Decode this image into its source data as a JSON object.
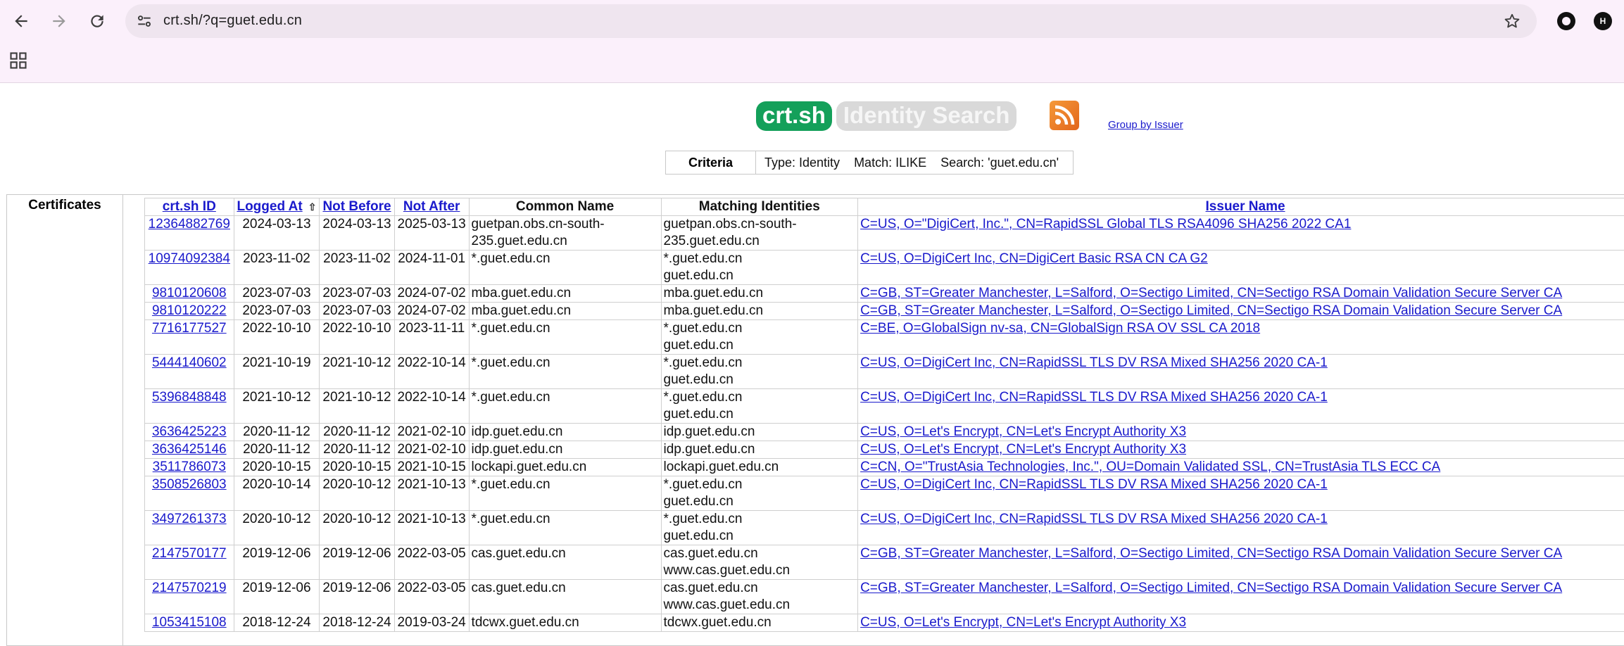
{
  "browser": {
    "url": "crt.sh/?q=guet.edu.cn",
    "profile_initial": "H"
  },
  "header": {
    "logo_main": "crt.sh",
    "logo_sub": "Identity Search",
    "group_link": "Group by Issuer"
  },
  "criteria": {
    "label": "Criteria",
    "text": "Type: Identity    Match: ILIKE    Search: 'guet.edu.cn'"
  },
  "table": {
    "section_label": "Certificates",
    "columns": {
      "id": "crt.sh ID",
      "logged_at": "Logged At",
      "sort_indicator": "⇧",
      "not_before": "Not Before",
      "not_after": "Not After",
      "common_name": "Common Name",
      "matching": "Matching Identities",
      "issuer": "Issuer Name"
    },
    "rows": [
      {
        "id": "12364882769",
        "logged": "2024-03-13",
        "nb": "2024-03-13",
        "na": "2025-03-13",
        "cn": "guetpan.obs.cn-south-235.guet.edu.cn",
        "match": "guetpan.obs.cn-south-235.guet.edu.cn",
        "issuer": "C=US, O=\"DigiCert, Inc.\", CN=RapidSSL Global TLS RSA4096 SHA256 2022 CA1"
      },
      {
        "id": "10974092384",
        "logged": "2023-11-02",
        "nb": "2023-11-02",
        "na": "2024-11-01",
        "cn": "*.guet.edu.cn",
        "match": "*.guet.edu.cn\nguet.edu.cn",
        "issuer": "C=US, O=DigiCert Inc, CN=DigiCert Basic RSA CN CA G2"
      },
      {
        "id": "9810120608",
        "logged": "2023-07-03",
        "nb": "2023-07-03",
        "na": "2024-07-02",
        "cn": "mba.guet.edu.cn",
        "match": "mba.guet.edu.cn",
        "issuer": "C=GB, ST=Greater Manchester, L=Salford, O=Sectigo Limited, CN=Sectigo RSA Domain Validation Secure Server CA"
      },
      {
        "id": "9810120222",
        "logged": "2023-07-03",
        "nb": "2023-07-03",
        "na": "2024-07-02",
        "cn": "mba.guet.edu.cn",
        "match": "mba.guet.edu.cn",
        "issuer": "C=GB, ST=Greater Manchester, L=Salford, O=Sectigo Limited, CN=Sectigo RSA Domain Validation Secure Server CA"
      },
      {
        "id": "7716177527",
        "logged": "2022-10-10",
        "nb": "2022-10-10",
        "na": "2023-11-11",
        "cn": "*.guet.edu.cn",
        "match": "*.guet.edu.cn\nguet.edu.cn",
        "issuer": "C=BE, O=GlobalSign nv-sa, CN=GlobalSign RSA OV SSL CA 2018"
      },
      {
        "id": "5444140602",
        "logged": "2021-10-19",
        "nb": "2021-10-12",
        "na": "2022-10-14",
        "cn": "*.guet.edu.cn",
        "match": "*.guet.edu.cn\nguet.edu.cn",
        "issuer": "C=US, O=DigiCert Inc, CN=RapidSSL TLS DV RSA Mixed SHA256 2020 CA-1"
      },
      {
        "id": "5396848848",
        "logged": "2021-10-12",
        "nb": "2021-10-12",
        "na": "2022-10-14",
        "cn": "*.guet.edu.cn",
        "match": "*.guet.edu.cn\nguet.edu.cn",
        "issuer": "C=US, O=DigiCert Inc, CN=RapidSSL TLS DV RSA Mixed SHA256 2020 CA-1"
      },
      {
        "id": "3636425223",
        "logged": "2020-11-12",
        "nb": "2020-11-12",
        "na": "2021-02-10",
        "cn": "idp.guet.edu.cn",
        "match": "idp.guet.edu.cn",
        "issuer": "C=US, O=Let's Encrypt, CN=Let's Encrypt Authority X3"
      },
      {
        "id": "3636425146",
        "logged": "2020-11-12",
        "nb": "2020-11-12",
        "na": "2021-02-10",
        "cn": "idp.guet.edu.cn",
        "match": "idp.guet.edu.cn",
        "issuer": "C=US, O=Let's Encrypt, CN=Let's Encrypt Authority X3"
      },
      {
        "id": "3511786073",
        "logged": "2020-10-15",
        "nb": "2020-10-15",
        "na": "2021-10-15",
        "cn": "lockapi.guet.edu.cn",
        "match": "lockapi.guet.edu.cn",
        "issuer": "C=CN, O=\"TrustAsia Technologies, Inc.\", OU=Domain Validated SSL, CN=TrustAsia TLS ECC CA"
      },
      {
        "id": "3508526803",
        "logged": "2020-10-14",
        "nb": "2020-10-12",
        "na": "2021-10-13",
        "cn": "*.guet.edu.cn",
        "match": "*.guet.edu.cn\nguet.edu.cn",
        "issuer": "C=US, O=DigiCert Inc, CN=RapidSSL TLS DV RSA Mixed SHA256 2020 CA-1"
      },
      {
        "id": "3497261373",
        "logged": "2020-10-12",
        "nb": "2020-10-12",
        "na": "2021-10-13",
        "cn": "*.guet.edu.cn",
        "match": "*.guet.edu.cn\nguet.edu.cn",
        "issuer": "C=US, O=DigiCert Inc, CN=RapidSSL TLS DV RSA Mixed SHA256 2020 CA-1"
      },
      {
        "id": "2147570177",
        "logged": "2019-12-06",
        "nb": "2019-12-06",
        "na": "2022-03-05",
        "cn": "cas.guet.edu.cn",
        "match": "cas.guet.edu.cn\nwww.cas.guet.edu.cn",
        "issuer": "C=GB, ST=Greater Manchester, L=Salford, O=Sectigo Limited, CN=Sectigo RSA Domain Validation Secure Server CA"
      },
      {
        "id": "2147570219",
        "logged": "2019-12-06",
        "nb": "2019-12-06",
        "na": "2022-03-05",
        "cn": "cas.guet.edu.cn",
        "match": "cas.guet.edu.cn\nwww.cas.guet.edu.cn",
        "issuer": "C=GB, ST=Greater Manchester, L=Salford, O=Sectigo Limited, CN=Sectigo RSA Domain Validation Secure Server CA"
      },
      {
        "id": "1053415108",
        "logged": "2018-12-24",
        "nb": "2018-12-24",
        "na": "2019-03-24",
        "cn": "tdcwx.guet.edu.cn",
        "match": "tdcwx.guet.edu.cn",
        "issuer": "C=US, O=Let's Encrypt, CN=Let's Encrypt Authority X3"
      }
    ]
  }
}
